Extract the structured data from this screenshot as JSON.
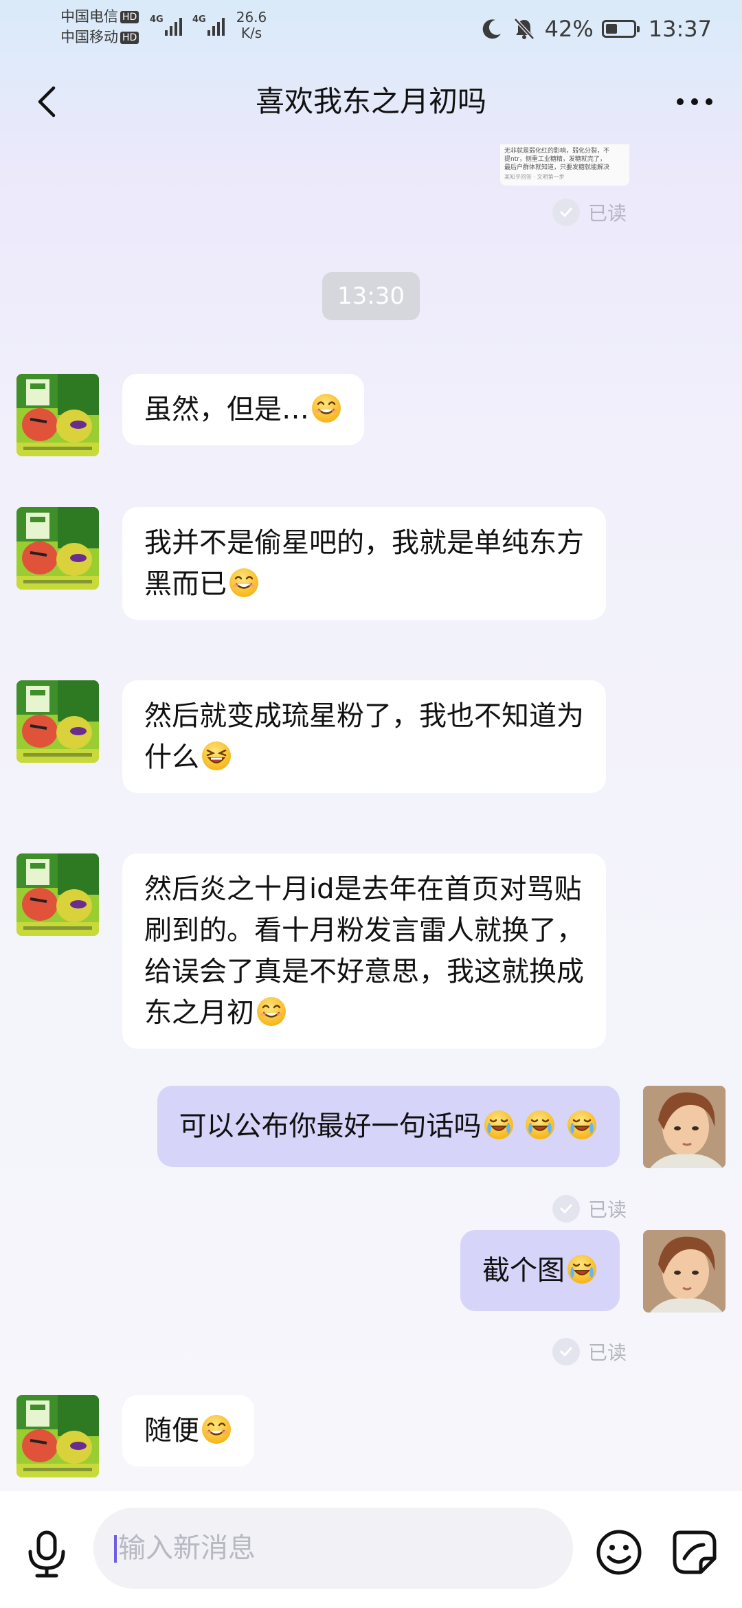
{
  "status_bar": {
    "carrier1": "中国电信",
    "carrier2": "中国移动",
    "hd_badge": "HD",
    "network_label": "4G",
    "net_speed_value": "26.6",
    "net_speed_unit": "K/s",
    "battery_percent": "42%",
    "battery_level": 0.42,
    "time": "13:37"
  },
  "header": {
    "title": "喜欢我东之月初吗"
  },
  "shared_image": {
    "line1": "无非就是弱化红的影响，弱化分裂，不",
    "line2": "提ntr，侧重工业糖精，发糖就完了，",
    "line3": "最后户群体就知道，只要发糖就能解决",
    "footer": "某知乎回答 · 文明第一步"
  },
  "read_label": "已读",
  "time_divider": "13:30",
  "messages": [
    {
      "direction": "in",
      "text": "虽然，但是…",
      "emoji": "smile-emoji"
    },
    {
      "direction": "in",
      "line1": "我并不是偷星吧的，我就是单纯东方",
      "line2": "黑而已",
      "emoji": "smile-emoji"
    },
    {
      "direction": "in",
      "line1": "然后就变成琉星粉了，我也不知道为",
      "line2": "什么",
      "emoji": "laugh-emoji"
    },
    {
      "direction": "in",
      "line1": "然后炎之十月id是去年在首页对骂贴",
      "line2": "刷到的。看十月粉发言雷人就换了，",
      "line3": "给误会了真是不好意思，我这就换成",
      "line4": "东之月初",
      "emoji": "smile-emoji"
    },
    {
      "direction": "out",
      "text": "可以公布你最好一句话吗",
      "emoji": "cry-laugh-emoji",
      "emoji_count": 3
    },
    {
      "direction": "out",
      "text": "截个图",
      "emoji": "cry-laugh-emoji"
    },
    {
      "direction": "in",
      "text": "随便",
      "emoji": "smile-emoji"
    }
  ],
  "input": {
    "placeholder": "输入新消息"
  },
  "icons": {
    "back": "back-arrow-icon",
    "more": "more-dots-icon",
    "mic": "microphone-icon",
    "emoji": "emoji-icon",
    "sticker": "sticker-icon",
    "moon": "moon-icon",
    "mute": "bell-off-icon"
  }
}
